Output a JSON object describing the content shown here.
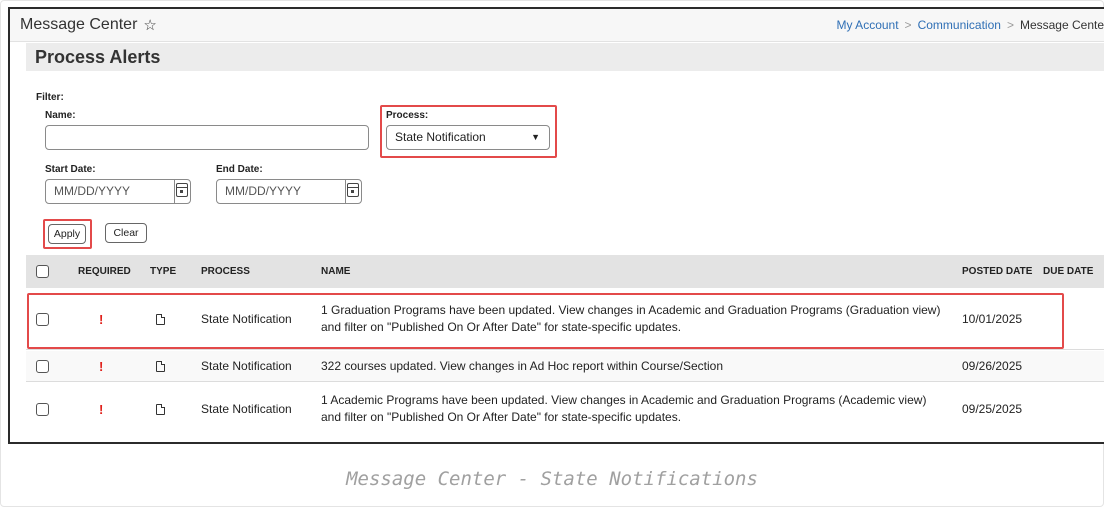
{
  "header": {
    "app_title": "Message Center",
    "star_glyph": "☆",
    "breadcrumbs": [
      "My Account",
      "Communication",
      "Message Cente"
    ],
    "crumb_sep": ">"
  },
  "section": {
    "title": "Process Alerts"
  },
  "filter": {
    "filter_label": "Filter:",
    "name_label": "Name:",
    "name_value": "",
    "process_label": "Process:",
    "process_value": "State Notification",
    "caret": "▼",
    "start_label": "Start Date:",
    "start_placeholder": "MM/DD/YYYY",
    "end_label": "End Date:",
    "end_placeholder": "MM/DD/YYYY",
    "apply_label": "Apply",
    "clear_label": "Clear"
  },
  "table": {
    "columns": [
      "REQUIRED",
      "TYPE",
      "PROCESS",
      "NAME",
      "POSTED DATE",
      "DUE DATE"
    ],
    "rows": [
      {
        "required": "!",
        "process": "State Notification",
        "name_line1": "1 Graduation Programs have been updated. View changes in Academic and Graduation Programs (Graduation view)",
        "name_line2": "and filter on \"Published On Or After Date\" for state-specific updates.",
        "posted": "10/01/2025",
        "due": ""
      },
      {
        "required": "!",
        "process": "State Notification",
        "name_line1": "322 courses updated. View changes in Ad Hoc report within Course/Section",
        "name_line2": "",
        "posted": "09/26/2025",
        "due": ""
      },
      {
        "required": "!",
        "process": "State Notification",
        "name_line1": "1 Academic Programs have been updated. View changes in Academic and Graduation Programs (Academic view)",
        "name_line2": "and filter on \"Published On Or After Date\" for state-specific updates.",
        "posted": "09/25/2025",
        "due": ""
      }
    ]
  },
  "caption": "Message Center - State Notifications",
  "colors": {
    "highlight": "#e34a4a",
    "link": "#2f6fb5",
    "required": "#e0201a"
  }
}
